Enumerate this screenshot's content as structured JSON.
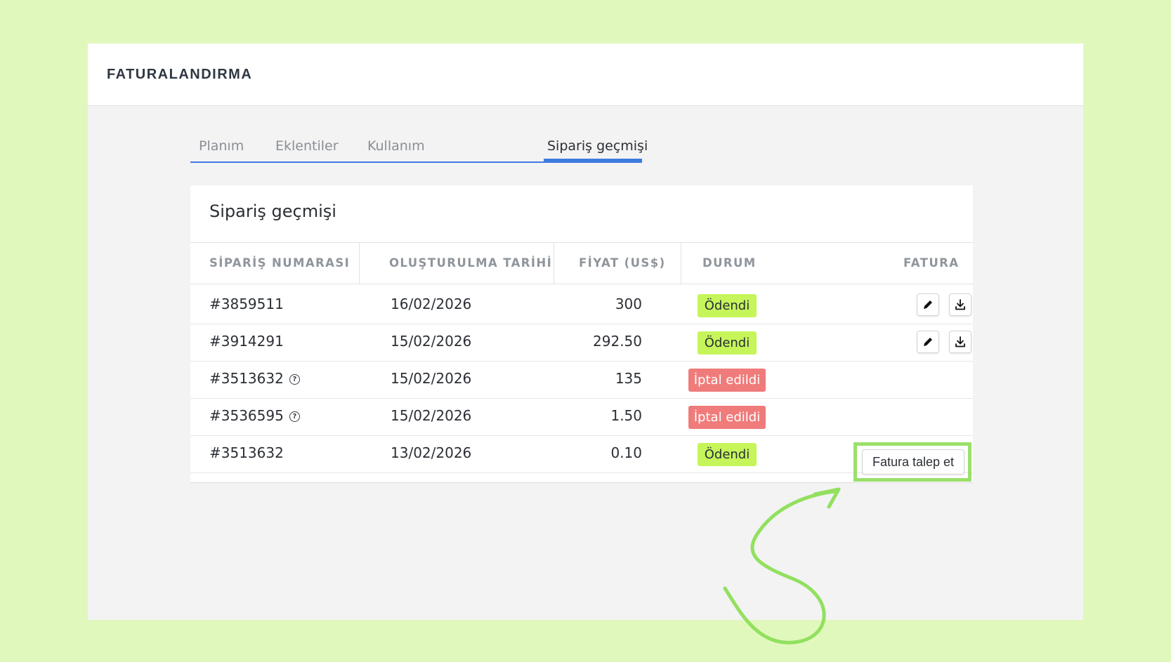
{
  "header": {
    "title": "FATURALANDIRMA"
  },
  "tabs": [
    {
      "label": "Planım"
    },
    {
      "label": "Eklentiler"
    },
    {
      "label": "Kullanım"
    },
    {
      "label": "Sipariş geçmişi",
      "active": true
    }
  ],
  "card": {
    "title": "Sipariş geçmişi",
    "columns": [
      "SİPARİŞ NUMARASI",
      "OLUŞTURULMA TARİHİ",
      "FİYAT (US$)",
      "DURUM",
      "FATURA"
    ],
    "rows": [
      {
        "order": "#3859511",
        "date": "16/02/2026",
        "price": "300",
        "status": "Ödendi",
        "status_type": "paid",
        "invoice": "icons",
        "help_icon": false
      },
      {
        "order": "#3914291",
        "date": "15/02/2026",
        "price": "292.50",
        "status": "Ödendi",
        "status_type": "paid",
        "invoice": "icons",
        "help_icon": false
      },
      {
        "order": "#3513632",
        "date": "15/02/2026",
        "price": "135",
        "status": "İptal edildi",
        "status_type": "cancelled",
        "invoice": "none",
        "help_icon": true
      },
      {
        "order": "#3536595",
        "date": "15/02/2026",
        "price": "1.50",
        "status": "İptal edildi",
        "status_type": "cancelled",
        "invoice": "none",
        "help_icon": true
      },
      {
        "order": "#3513632",
        "date": "13/02/2026",
        "price": "0.10",
        "status": "Ödendi",
        "status_type": "paid",
        "invoice": "request",
        "help_icon": false
      }
    ]
  },
  "request_invoice_label": "Fatura talep et",
  "colors": {
    "background": "#e1f8bd",
    "accent": "#3f7be0",
    "paid": "#c6f55a",
    "cancelled": "#f07b7b",
    "highlight": "#9ae06a"
  },
  "icons": [
    "edit-icon",
    "download-icon",
    "help-circle-icon"
  ]
}
